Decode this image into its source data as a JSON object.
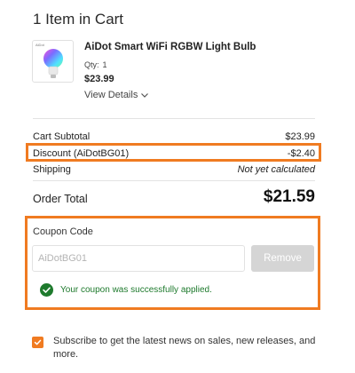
{
  "cart": {
    "title": "1 Item in Cart"
  },
  "product": {
    "thumb_brand": "AiDot",
    "name": "AiDot Smart WiFi RGBW Light Bulb",
    "qty_label": "Qty:",
    "qty_value": "1",
    "price": "$23.99",
    "view_details": "View Details"
  },
  "summary": {
    "subtotal_label": "Cart Subtotal",
    "subtotal_value": "$23.99",
    "discount_label": "Discount (AiDotBG01)",
    "discount_value": "-$2.40",
    "shipping_label": "Shipping",
    "shipping_value": "Not yet calculated",
    "total_label": "Order Total",
    "total_value": "$21.59"
  },
  "coupon": {
    "label": "Coupon Code",
    "input_value": "AiDotBG01",
    "remove_label": "Remove",
    "success_message": "Your coupon was successfully applied."
  },
  "subscribe": {
    "checked": true,
    "text": "Subscribe to get the latest news on sales, new releases, and more."
  },
  "colors": {
    "highlight": "#f07b21",
    "success": "#1e7a2d",
    "button_disabled": "#d5d5d5"
  }
}
